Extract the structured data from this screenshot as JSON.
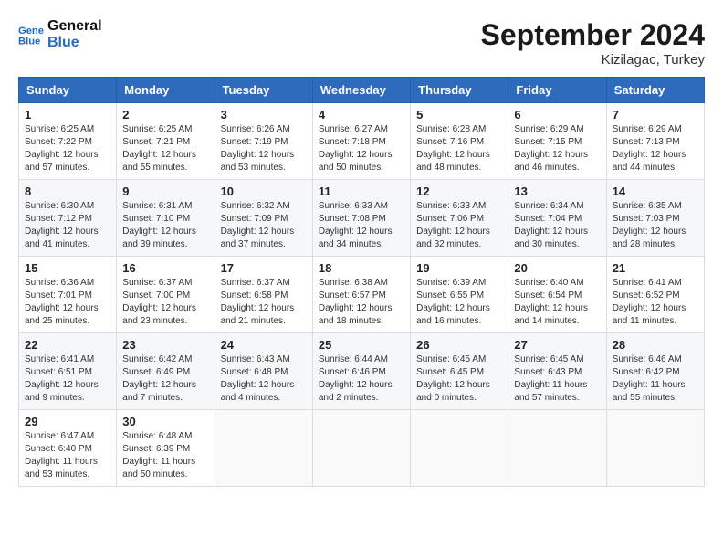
{
  "header": {
    "logo_line1": "General",
    "logo_line2": "Blue",
    "month_title": "September 2024",
    "location": "Kizilagac, Turkey"
  },
  "columns": [
    "Sunday",
    "Monday",
    "Tuesday",
    "Wednesday",
    "Thursday",
    "Friday",
    "Saturday"
  ],
  "weeks": [
    [
      {
        "day": "1",
        "text": "Sunrise: 6:25 AM\nSunset: 7:22 PM\nDaylight: 12 hours\nand 57 minutes."
      },
      {
        "day": "2",
        "text": "Sunrise: 6:25 AM\nSunset: 7:21 PM\nDaylight: 12 hours\nand 55 minutes."
      },
      {
        "day": "3",
        "text": "Sunrise: 6:26 AM\nSunset: 7:19 PM\nDaylight: 12 hours\nand 53 minutes."
      },
      {
        "day": "4",
        "text": "Sunrise: 6:27 AM\nSunset: 7:18 PM\nDaylight: 12 hours\nand 50 minutes."
      },
      {
        "day": "5",
        "text": "Sunrise: 6:28 AM\nSunset: 7:16 PM\nDaylight: 12 hours\nand 48 minutes."
      },
      {
        "day": "6",
        "text": "Sunrise: 6:29 AM\nSunset: 7:15 PM\nDaylight: 12 hours\nand 46 minutes."
      },
      {
        "day": "7",
        "text": "Sunrise: 6:29 AM\nSunset: 7:13 PM\nDaylight: 12 hours\nand 44 minutes."
      }
    ],
    [
      {
        "day": "8",
        "text": "Sunrise: 6:30 AM\nSunset: 7:12 PM\nDaylight: 12 hours\nand 41 minutes."
      },
      {
        "day": "9",
        "text": "Sunrise: 6:31 AM\nSunset: 7:10 PM\nDaylight: 12 hours\nand 39 minutes."
      },
      {
        "day": "10",
        "text": "Sunrise: 6:32 AM\nSunset: 7:09 PM\nDaylight: 12 hours\nand 37 minutes."
      },
      {
        "day": "11",
        "text": "Sunrise: 6:33 AM\nSunset: 7:08 PM\nDaylight: 12 hours\nand 34 minutes."
      },
      {
        "day": "12",
        "text": "Sunrise: 6:33 AM\nSunset: 7:06 PM\nDaylight: 12 hours\nand 32 minutes."
      },
      {
        "day": "13",
        "text": "Sunrise: 6:34 AM\nSunset: 7:04 PM\nDaylight: 12 hours\nand 30 minutes."
      },
      {
        "day": "14",
        "text": "Sunrise: 6:35 AM\nSunset: 7:03 PM\nDaylight: 12 hours\nand 28 minutes."
      }
    ],
    [
      {
        "day": "15",
        "text": "Sunrise: 6:36 AM\nSunset: 7:01 PM\nDaylight: 12 hours\nand 25 minutes."
      },
      {
        "day": "16",
        "text": "Sunrise: 6:37 AM\nSunset: 7:00 PM\nDaylight: 12 hours\nand 23 minutes."
      },
      {
        "day": "17",
        "text": "Sunrise: 6:37 AM\nSunset: 6:58 PM\nDaylight: 12 hours\nand 21 minutes."
      },
      {
        "day": "18",
        "text": "Sunrise: 6:38 AM\nSunset: 6:57 PM\nDaylight: 12 hours\nand 18 minutes."
      },
      {
        "day": "19",
        "text": "Sunrise: 6:39 AM\nSunset: 6:55 PM\nDaylight: 12 hours\nand 16 minutes."
      },
      {
        "day": "20",
        "text": "Sunrise: 6:40 AM\nSunset: 6:54 PM\nDaylight: 12 hours\nand 14 minutes."
      },
      {
        "day": "21",
        "text": "Sunrise: 6:41 AM\nSunset: 6:52 PM\nDaylight: 12 hours\nand 11 minutes."
      }
    ],
    [
      {
        "day": "22",
        "text": "Sunrise: 6:41 AM\nSunset: 6:51 PM\nDaylight: 12 hours\nand 9 minutes."
      },
      {
        "day": "23",
        "text": "Sunrise: 6:42 AM\nSunset: 6:49 PM\nDaylight: 12 hours\nand 7 minutes."
      },
      {
        "day": "24",
        "text": "Sunrise: 6:43 AM\nSunset: 6:48 PM\nDaylight: 12 hours\nand 4 minutes."
      },
      {
        "day": "25",
        "text": "Sunrise: 6:44 AM\nSunset: 6:46 PM\nDaylight: 12 hours\nand 2 minutes."
      },
      {
        "day": "26",
        "text": "Sunrise: 6:45 AM\nSunset: 6:45 PM\nDaylight: 12 hours\nand 0 minutes."
      },
      {
        "day": "27",
        "text": "Sunrise: 6:45 AM\nSunset: 6:43 PM\nDaylight: 11 hours\nand 57 minutes."
      },
      {
        "day": "28",
        "text": "Sunrise: 6:46 AM\nSunset: 6:42 PM\nDaylight: 11 hours\nand 55 minutes."
      }
    ],
    [
      {
        "day": "29",
        "text": "Sunrise: 6:47 AM\nSunset: 6:40 PM\nDaylight: 11 hours\nand 53 minutes."
      },
      {
        "day": "30",
        "text": "Sunrise: 6:48 AM\nSunset: 6:39 PM\nDaylight: 11 hours\nand 50 minutes."
      },
      {
        "day": "",
        "text": ""
      },
      {
        "day": "",
        "text": ""
      },
      {
        "day": "",
        "text": ""
      },
      {
        "day": "",
        "text": ""
      },
      {
        "day": "",
        "text": ""
      }
    ]
  ]
}
